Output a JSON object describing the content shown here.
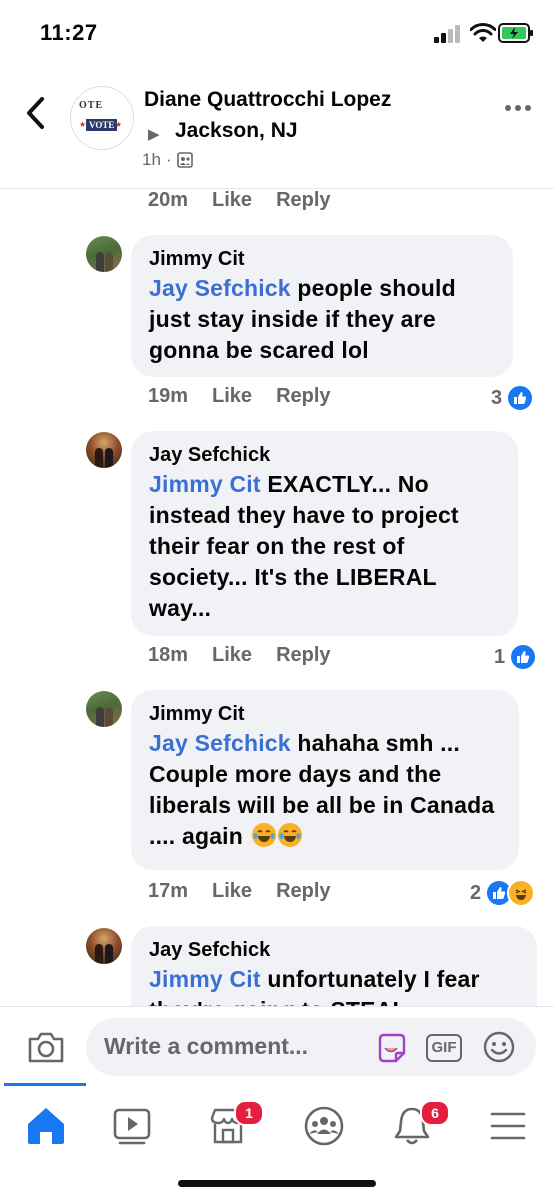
{
  "status_bar": {
    "time": "11:27"
  },
  "header": {
    "back_icon": "chevron-left-icon",
    "group_avatar": {
      "line1": "OTE",
      "line2": "VOTE"
    },
    "poster_name": "Diane Quattrocchi Lopez",
    "group_name": "Jackson, NJ",
    "time": "1h",
    "separator": "·",
    "privacy_icon": "group-icon",
    "more_icon": "more-icon"
  },
  "feed": {
    "top_action": {
      "time": "20m",
      "like": "Like",
      "reply": "Reply"
    },
    "comments": [
      {
        "author": "Jimmy Cit",
        "mention": "Jay Sefchick",
        "text": " people should just stay inside if they are gonna be scared lol",
        "time": "19m",
        "like": "Like",
        "reply": "Reply",
        "reaction_count": "3",
        "reactions": [
          "like"
        ]
      },
      {
        "author": "Jay Sefchick",
        "mention": "Jimmy Cit",
        "text": " EXACTLY... No instead they have to project their fear on the rest of society... It's the LIBERAL way...",
        "time": "18m",
        "like": "Like",
        "reply": "Reply",
        "reaction_count": "1",
        "reactions": [
          "like"
        ]
      },
      {
        "author": "Jimmy Cit",
        "mention": "Jay Sefchick",
        "text": " hahaha smh ... Couple more days and the liberals will be all be in Canada .... again",
        "emoji": [
          "laughing-tears-emoji",
          "laughing-tears-emoji"
        ],
        "time": "17m",
        "like": "Like",
        "reply": "Reply",
        "reaction_count": "2",
        "reactions": [
          "like",
          "haha"
        ]
      },
      {
        "author": "Jay Sefchick",
        "mention": "Jimmy Cit",
        "text": " unfortunately I fear they're going to STEAL"
      }
    ]
  },
  "composer": {
    "placeholder": "Write a comment...",
    "camera_icon": "camera-icon",
    "sticker_icon": "sticker-icon",
    "gif_label": "GIF",
    "emoji_icon": "smiley-icon"
  },
  "tabbar": {
    "tabs": [
      {
        "name": "home",
        "icon": "home-icon",
        "active": true
      },
      {
        "name": "watch",
        "icon": "video-icon"
      },
      {
        "name": "marketplace",
        "icon": "shop-icon",
        "badge": "1"
      },
      {
        "name": "groups",
        "icon": "groups-icon"
      },
      {
        "name": "notifications",
        "icon": "bell-icon",
        "badge": "6"
      },
      {
        "name": "menu",
        "icon": "menu-icon"
      }
    ]
  },
  "colors": {
    "accent": "#1877f2",
    "mention": "#3b6fd3",
    "bubble": "#f0f2f5",
    "secondary_text": "#65676b",
    "badge": "#e41e3f"
  }
}
